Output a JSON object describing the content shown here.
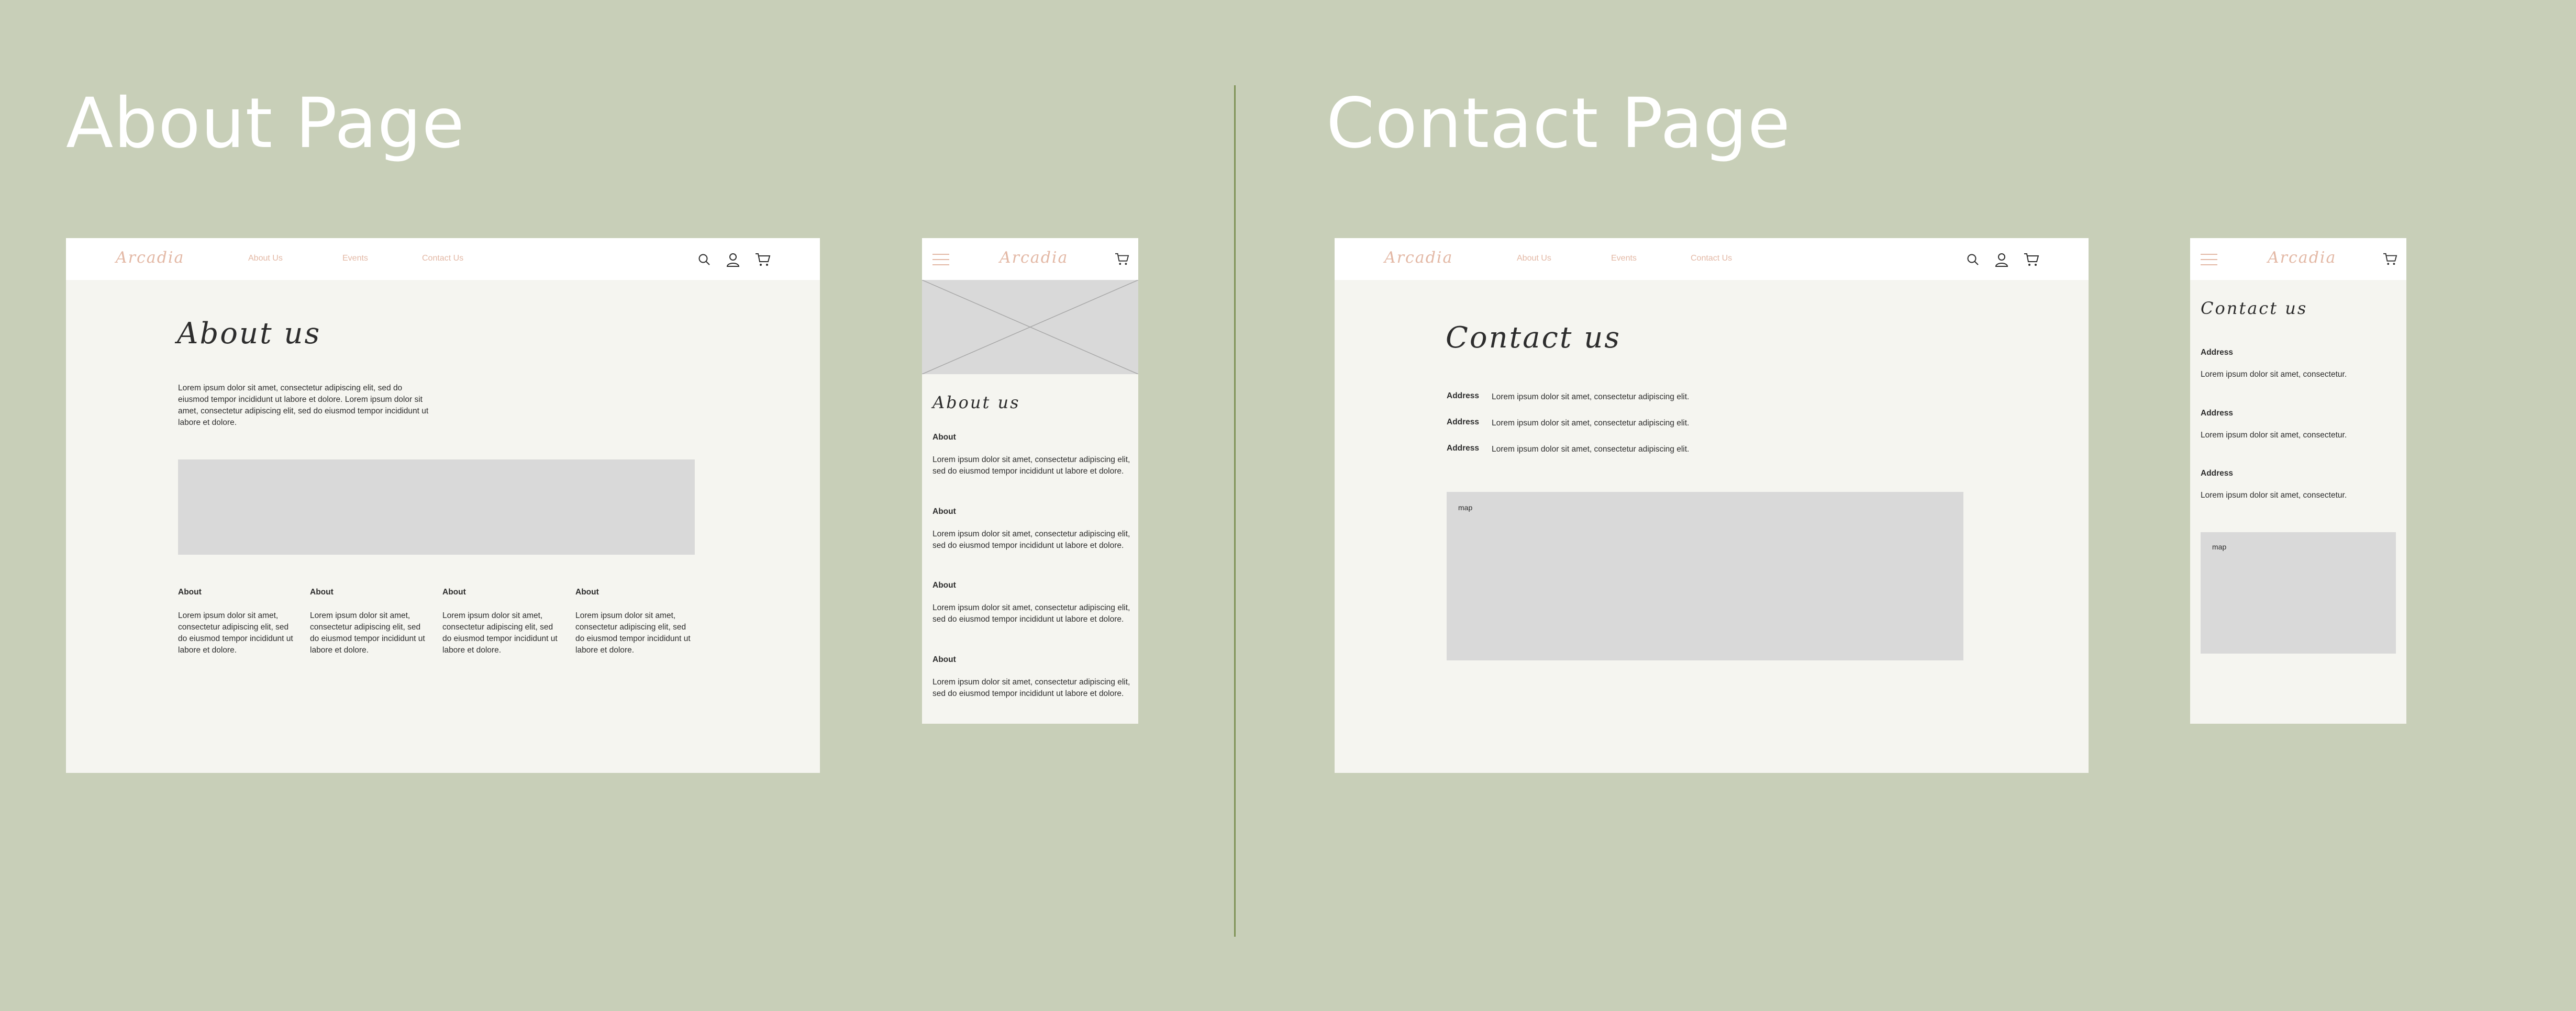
{
  "about_section": {
    "title": "About Page"
  },
  "contact_section": {
    "title": "Contact Page"
  },
  "nav": {
    "logo": "Arcadia",
    "links": [
      "About Us",
      "Events",
      "Contact Us"
    ]
  },
  "about_desktop": {
    "heading": "About us",
    "intro": "Lorem ipsum dolor sit amet, consectetur adipiscing elit, sed do eiusmod tempor incididunt ut labore et dolore. Lorem ipsum dolor sit amet, consectetur adipiscing elit, sed do eiusmod tempor incididunt ut labore et dolore.",
    "columns": [
      {
        "label": "About",
        "text": "Lorem ipsum dolor sit amet, consectetur adipiscing elit, sed do eiusmod tempor incididunt ut labore et dolore."
      },
      {
        "label": "About",
        "text": "Lorem ipsum dolor sit amet, consectetur adipiscing elit, sed do eiusmod tempor incididunt ut labore et dolore."
      },
      {
        "label": "About",
        "text": "Lorem ipsum dolor sit amet, consectetur adipiscing elit, sed do eiusmod tempor incididunt ut labore et dolore."
      },
      {
        "label": "About",
        "text": "Lorem ipsum dolor sit amet, consectetur adipiscing elit, sed do eiusmod tempor incididunt ut labore et dolore."
      }
    ]
  },
  "about_mobile": {
    "heading": "About us",
    "items": [
      {
        "label": "About",
        "text": "Lorem ipsum dolor sit amet, consectetur adipiscing elit, sed do eiusmod tempor incididunt ut labore et dolore."
      },
      {
        "label": "About",
        "text": "Lorem ipsum dolor sit amet, consectetur adipiscing elit, sed do eiusmod tempor incididunt ut labore et dolore."
      },
      {
        "label": "About",
        "text": "Lorem ipsum dolor sit amet, consectetur adipiscing elit, sed do eiusmod tempor incididunt ut labore et dolore."
      },
      {
        "label": "About",
        "text": "Lorem ipsum dolor sit amet, consectetur adipiscing elit, sed do eiusmod tempor incididunt ut labore et dolore."
      }
    ]
  },
  "contact_desktop": {
    "heading": "Contact us",
    "rows": [
      {
        "label": "Address",
        "text": "Lorem ipsum dolor sit amet, consectetur adipiscing elit."
      },
      {
        "label": "Address",
        "text": "Lorem ipsum dolor sit amet, consectetur adipiscing elit."
      },
      {
        "label": "Address",
        "text": "Lorem ipsum dolor sit amet, consectetur adipiscing elit."
      }
    ],
    "map_label": "map"
  },
  "contact_mobile": {
    "heading": "Contact us",
    "items": [
      {
        "label": "Address",
        "text": "Lorem ipsum dolor sit amet, consectetur."
      },
      {
        "label": "Address",
        "text": "Lorem ipsum dolor sit amet, consectetur."
      },
      {
        "label": "Address",
        "text": "Lorem ipsum dolor sit amet, consectetur."
      }
    ],
    "map_label": "map"
  },
  "colors": {
    "background": "#c8cfb8",
    "frame": "#f5f5f0",
    "navbar": "#ffffff",
    "placeholder": "#d9d9d9",
    "logo_accent": "#e3b8a5",
    "divider": "#7f9357",
    "text": "#2d2d2d"
  },
  "icons": [
    "search-icon",
    "user-icon",
    "cart-icon",
    "hamburger-menu-icon"
  ]
}
